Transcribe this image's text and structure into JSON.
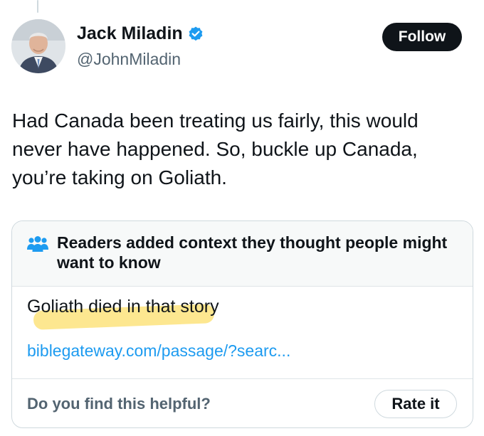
{
  "author": {
    "name": "Jack Miladin",
    "handle": "@JohnMiladin",
    "verified": true
  },
  "follow_label": "Follow",
  "tweet": {
    "text": "Had Canada been treating us fairly, this would never have happened. So, buckle up Canada, you’re taking on Goliath."
  },
  "community_note": {
    "title": "Readers added context they thought people might want to know",
    "body": "Goliath died in that story",
    "link": "biblegateway.com/passage/?searc...",
    "helpful_question": "Do you find this helpful?",
    "rate_label": "Rate it"
  },
  "icons": {
    "verified": "verified-badge-icon",
    "note": "people-group-icon"
  },
  "colors": {
    "accent": "#1d9bf0",
    "follow_bg": "#0f1419",
    "highlight": "#fde68a",
    "muted": "#536471"
  }
}
